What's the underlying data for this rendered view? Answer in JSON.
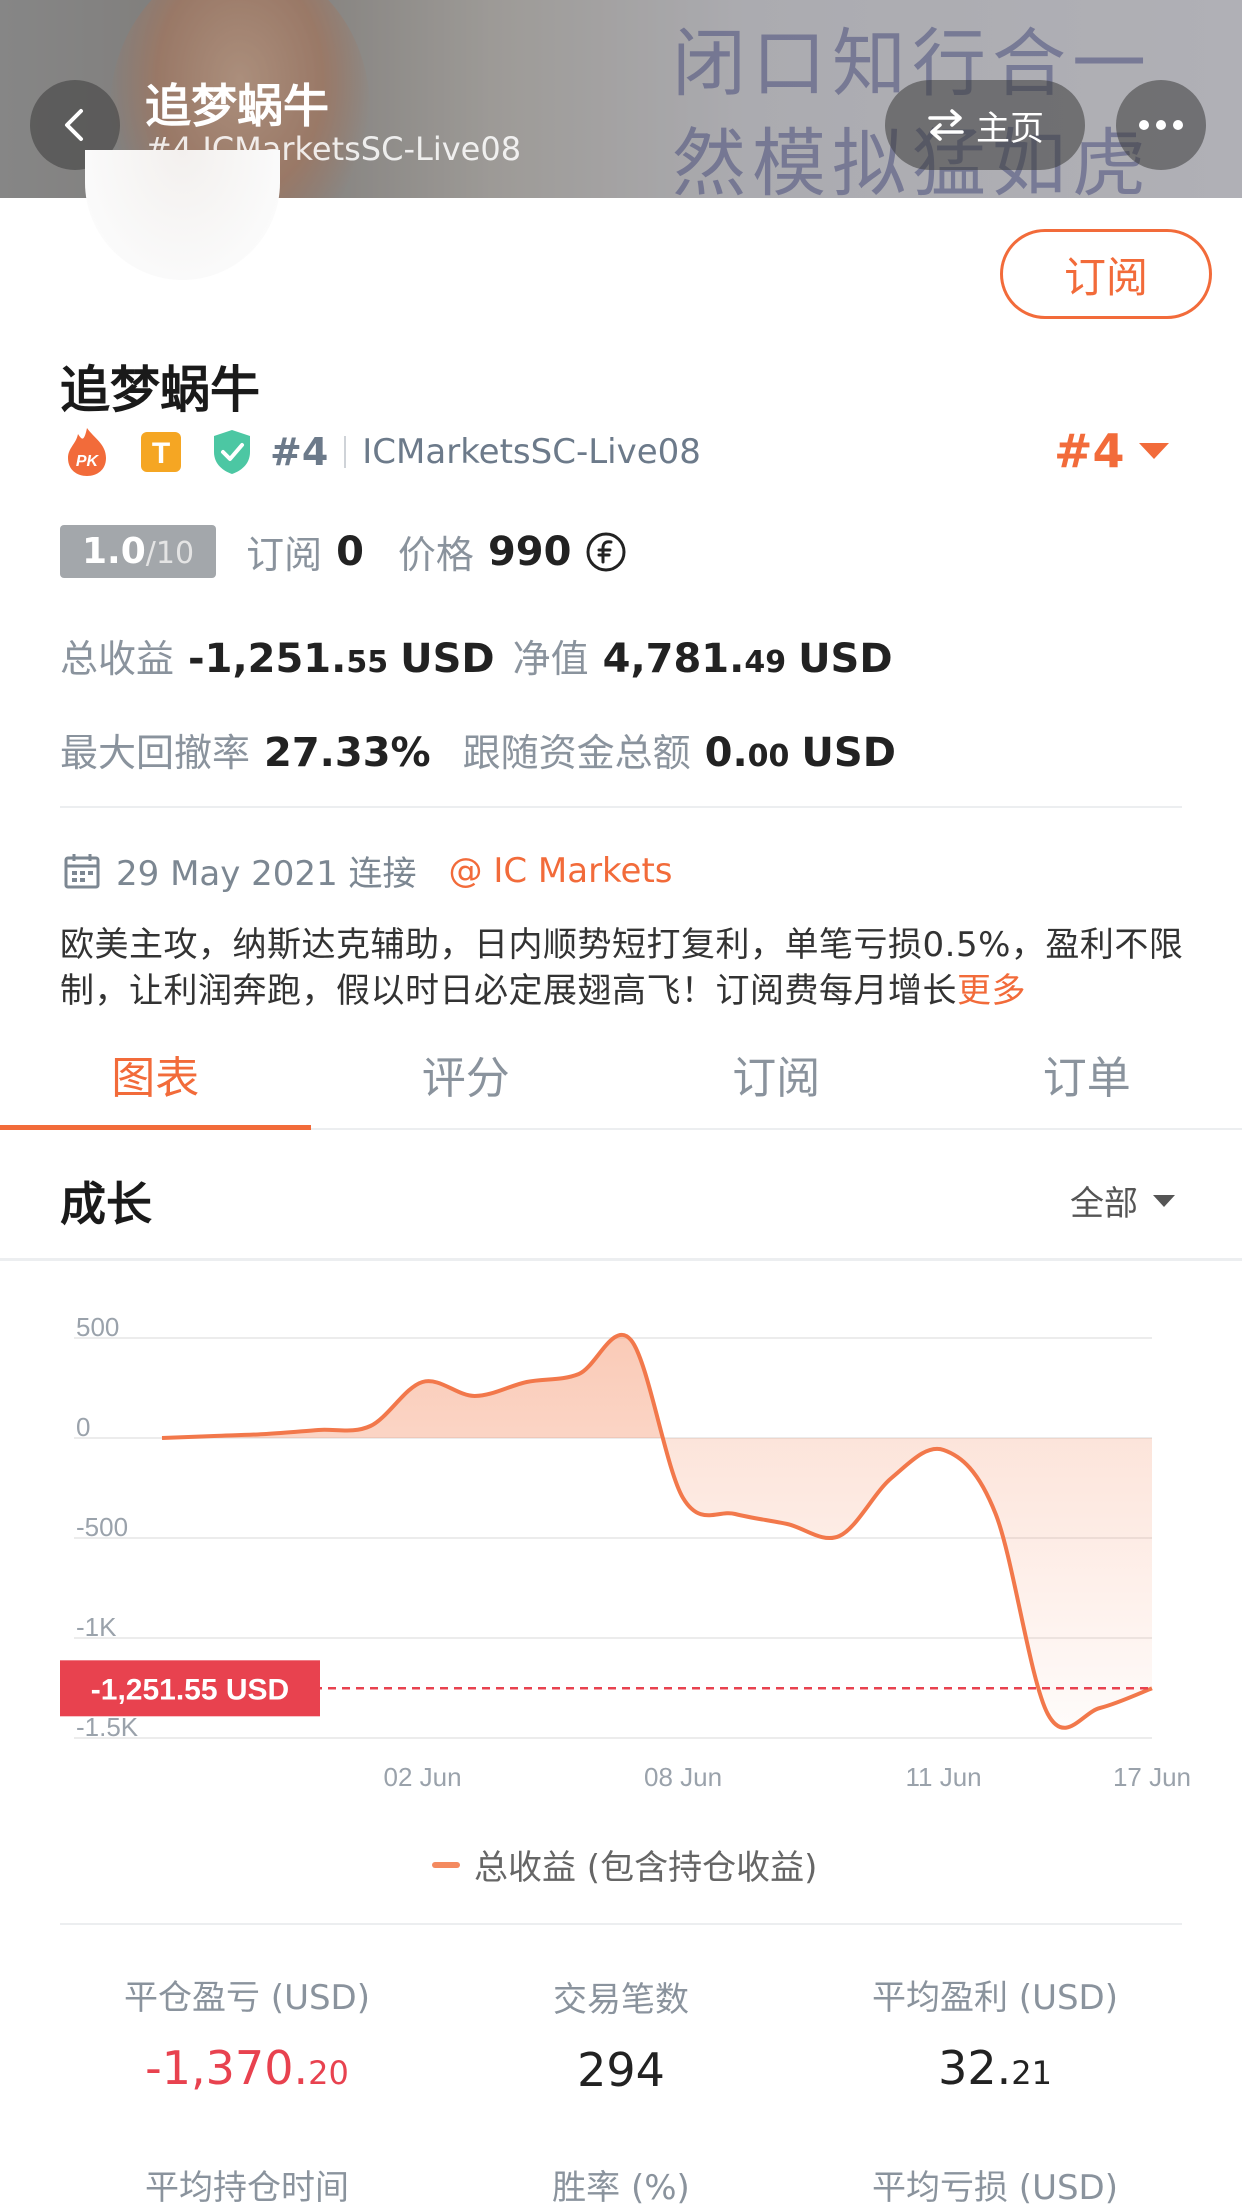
{
  "header": {
    "name": "追梦蜗牛",
    "subtitle": "#4 ICMarketsSC-Live08",
    "bg_text_line1": "闭口知行合一",
    "bg_text_line2": "然模拟猛如虎",
    "home_label": "主页"
  },
  "profile": {
    "subscribe_label": "订阅",
    "name": "追梦蜗牛",
    "badges": [
      "PK",
      "T",
      "shield"
    ],
    "rank": "#4",
    "server": "ICMarketsSC-Live08",
    "rank_right": "#4",
    "rating": "1.0",
    "rating_max": "/10",
    "subscribe_count_label": "订阅",
    "subscribe_count": "0",
    "price_label": "价格",
    "price": "990",
    "total_profit_label": "总收益",
    "total_profit_int": "-1,251.",
    "total_profit_dec": "55",
    "total_profit_unit": "USD",
    "equity_label": "净值",
    "equity_int": "4,781.",
    "equity_dec": "49",
    "equity_unit": "USD",
    "drawdown_label": "最大回撤率",
    "drawdown": "27.33%",
    "follow_label": "跟随资金总额",
    "follow_int": "0.",
    "follow_dec": "00",
    "follow_unit": "USD",
    "connect_date": "29 May 2021 连接",
    "broker": "@ IC Markets",
    "description": "欧美主攻，纳斯达克辅助，日内顺势短打复利，单笔亏损0.5%，盈利不限制，让利润奔跑，假以时日必定展翅高飞！订阅费每月增长",
    "more_label": "更多"
  },
  "tabs": [
    "图表",
    "评分",
    "订阅",
    "订单"
  ],
  "growth": {
    "title": "成长",
    "range": "全部"
  },
  "chart_data": {
    "type": "area",
    "y_ticks": [
      "500",
      "0",
      "-500",
      "-1K",
      "-1.5K"
    ],
    "y_tick_values": [
      500,
      0,
      -500,
      -1000,
      -1500
    ],
    "ylim": [
      -1500,
      500
    ],
    "x_tick_labels": [
      "02 Jun",
      "08 Jun",
      "11 Jun",
      "17 Jun"
    ],
    "x_tick_index": [
      5,
      10,
      15,
      19
    ],
    "series": [
      {
        "name": "总收益 (包含持仓收益)",
        "values": [
          0,
          10,
          20,
          40,
          60,
          280,
          210,
          280,
          320,
          490,
          -300,
          -380,
          -430,
          -490,
          -200,
          -60,
          -380,
          -1380,
          -1350,
          -1251.55
        ]
      }
    ],
    "current_value_label": "-1,251.55 USD",
    "current_value": -1251.55,
    "line_color": "#f2784b"
  },
  "metrics": [
    {
      "label": "平仓盈亏 (USD)",
      "int": "-1,370.",
      "dec": "20",
      "negative": true
    },
    {
      "label": "交易笔数",
      "int": "294",
      "dec": "",
      "negative": false
    },
    {
      "label": "平均盈利 (USD)",
      "int": "32.",
      "dec": "21",
      "negative": false
    },
    {
      "label": "平均持仓时间",
      "int": "",
      "dec": "",
      "negative": false
    },
    {
      "label": "胜率 (%)",
      "int": "",
      "dec": "",
      "negative": false
    },
    {
      "label": "平均亏损 (USD)",
      "int": "",
      "dec": "",
      "negative": false
    }
  ]
}
